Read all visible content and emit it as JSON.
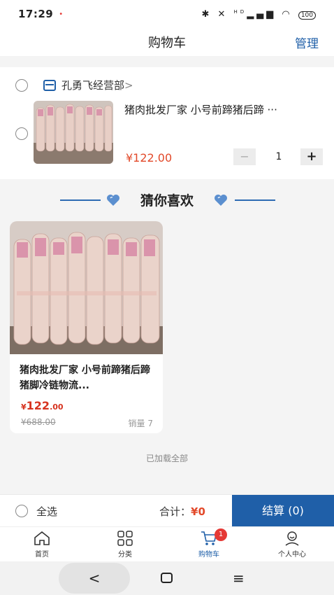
{
  "status_bar": {
    "time": "17:29",
    "indicator": "•",
    "icons": [
      "bluetooth-icon",
      "mute-icon",
      "signal-icon",
      "wifi-icon",
      "battery-icon"
    ],
    "signal_text": "HD",
    "battery": "100"
  },
  "nav": {
    "title": "购物车",
    "manage": "管理"
  },
  "cart": {
    "shop_name": "孔勇飞经营部",
    "shop_arrow": ">",
    "item": {
      "title": "猪肉批发厂家 小号前蹄猪后蹄 ···",
      "price": "¥122.00",
      "qty": "1",
      "minus": "−",
      "plus": "+"
    }
  },
  "recommend": {
    "heading": "猜你喜欢",
    "product": {
      "title": "猪肉批发厂家 小号前蹄猪后蹄 猪脚冷链物流...",
      "price_symbol": "¥",
      "price_main": "122",
      "price_decimal": ".00",
      "old_price": "¥688.00",
      "sales": "销量 7"
    }
  },
  "loaded_text": "已加载全部",
  "checkout": {
    "select_all": "全选",
    "total_label": "合计：",
    "total_amount": "¥0",
    "button": "结算 (0)"
  },
  "tabs": [
    {
      "label": "首页",
      "icon": "home-icon"
    },
    {
      "label": "分类",
      "icon": "grid-icon"
    },
    {
      "label": "购物车",
      "icon": "cart-icon",
      "badge": "1"
    },
    {
      "label": "个人中心",
      "icon": "user-icon"
    }
  ],
  "system_nav": {
    "back": "<",
    "menu": "≡"
  },
  "colors": {
    "accent": "#1f5fa8",
    "price": "#e2492a",
    "badge": "#e53935"
  }
}
